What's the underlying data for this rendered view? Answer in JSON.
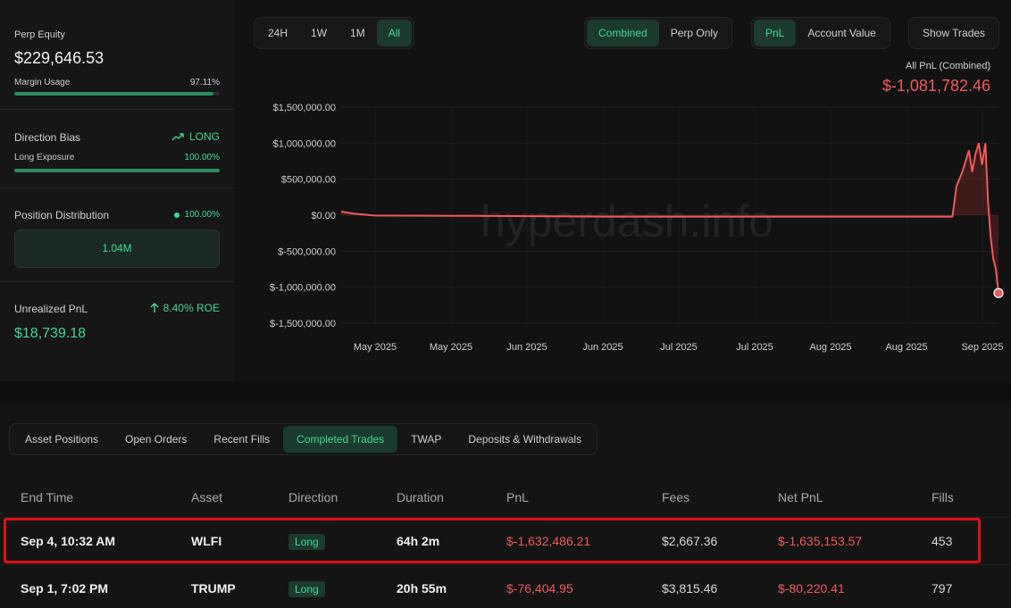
{
  "summary": {
    "perp_equity_label": "Perp Equity",
    "perp_equity_value": "$229,646.53",
    "margin_usage_label": "Margin Usage",
    "margin_usage_value": "97.11%",
    "margin_usage_fraction": 0.9711,
    "direction_bias_label": "Direction Bias",
    "direction_bias_value": "LONG",
    "long_exposure_label": "Long Exposure",
    "long_exposure_value": "100.00%",
    "long_exposure_fraction": 1.0,
    "position_distribution_label": "Position Distribution",
    "position_distribution_value": "100.00%",
    "position_distribution_bar_text": "1.04M",
    "unrealized_pnl_label": "Unrealized PnL",
    "unrealized_roe": "8.40% ROE",
    "unrealized_pnl_value": "$18,739.18"
  },
  "timeframes": [
    "24H",
    "1W",
    "1M",
    "All"
  ],
  "timeframe_selected": "All",
  "scope_toggle": [
    "Combined",
    "Perp Only"
  ],
  "scope_selected": "Combined",
  "metric_toggle": [
    "PnL",
    "Account Value"
  ],
  "metric_selected": "PnL",
  "show_trades_label": "Show Trades",
  "chart_header": {
    "label": "All PnL (Combined)",
    "value": "$-1,081,782.46"
  },
  "watermark": "hyperdash.info",
  "chart_data": {
    "type": "area",
    "title": "All PnL (Combined)",
    "y_tick_labels": [
      "$1,500,000.00",
      "$1,000,000.00",
      "$500,000.00",
      "$0.00",
      "$-500,000.00",
      "$-1,000,000.00",
      "$-1,500,000.00"
    ],
    "y_ticks": [
      1500000,
      1000000,
      500000,
      0,
      -500000,
      -1000000,
      -1500000
    ],
    "x_tick_labels": [
      "May 2025",
      "May 2025",
      "Jun 2025",
      "Jun 2025",
      "Jul 2025",
      "Jul 2025",
      "Aug 2025",
      "Aug 2025",
      "Sep 2025"
    ],
    "ylim": [
      -1500000,
      1500000
    ],
    "grid": true,
    "x": [
      0,
      0.02,
      0.05,
      0.2,
      0.4,
      0.6,
      0.8,
      0.93,
      0.936,
      0.945,
      0.955,
      0.96,
      0.965,
      0.97,
      0.975,
      0.98,
      0.984,
      0.988,
      0.992,
      0.996,
      1.0
    ],
    "values": [
      50000,
      20000,
      -5000,
      -10000,
      -20000,
      -20000,
      -20000,
      -20000,
      400000,
      600000,
      900000,
      600000,
      850000,
      1000000,
      700000,
      1000000,
      200000,
      -300000,
      -600000,
      -750000,
      -1081782
    ]
  },
  "table_tabs": [
    "Asset Positions",
    "Open Orders",
    "Recent Fills",
    "Completed Trades",
    "TWAP",
    "Deposits & Withdrawals"
  ],
  "table_tab_selected": "Completed Trades",
  "table": {
    "headers": [
      "End Time",
      "Asset",
      "Direction",
      "Duration",
      "PnL",
      "Fees",
      "Net PnL",
      "Fills"
    ],
    "rows": [
      {
        "end_time": "Sep 4, 10:32 AM",
        "asset": "WLFI",
        "direction": "Long",
        "duration": "64h 2m",
        "pnl": "$-1,632,486.21",
        "fees": "$2,667.36",
        "net_pnl": "$-1,635,153.57",
        "fills": "453"
      },
      {
        "end_time": "Sep 1, 7:02 PM",
        "asset": "TRUMP",
        "direction": "Long",
        "duration": "20h 55m",
        "pnl": "$-76,404.95",
        "fees": "$3,815.46",
        "net_pnl": "$-80,220.41",
        "fills": "797"
      }
    ]
  },
  "colors": {
    "accent_green": "#3ddc97",
    "loss_red": "#f05a5a",
    "highlight_red": "#e01010"
  }
}
